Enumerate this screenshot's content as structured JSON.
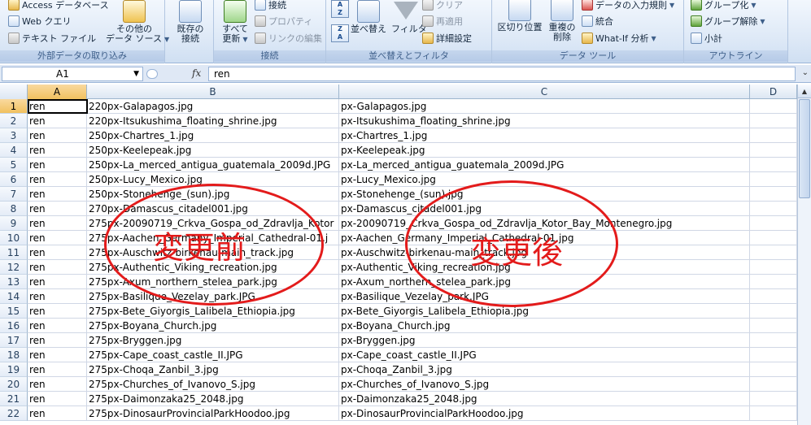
{
  "ribbon": {
    "groups": {
      "external": {
        "label": "外部データの取り込み",
        "access": "Access データベース",
        "web": "Web クエリ",
        "text": "テキスト ファイル",
        "other_l1": "その他の",
        "other_l2": "データ ソース"
      },
      "connections": {
        "label": "接続",
        "existing_l1": "既存の",
        "existing_l2": "接続",
        "refresh_l1": "すべて",
        "refresh_l2": "更新",
        "connections": "接続",
        "properties": "プロパティ",
        "edit_links": "リンクの編集"
      },
      "sort_filter": {
        "label": "並べ替えとフィルタ",
        "sort": "並べ替え",
        "filter": "フィルタ",
        "clear": "クリア",
        "reapply": "再適用",
        "advanced": "詳細設定"
      },
      "data_tools": {
        "label": "データ ツール",
        "text_to_columns": "区切り位置",
        "remove_dup_l1": "重複の",
        "remove_dup_l2": "削除",
        "validation": "データの入力規則",
        "consolidate": "統合",
        "whatif": "What-If 分析"
      },
      "outline": {
        "label": "アウトライン",
        "group": "グループ化",
        "ungroup": "グループ解除",
        "subtotal": "小計"
      }
    }
  },
  "formula_bar": {
    "name_box": "A1",
    "fx": "fx",
    "value": "ren"
  },
  "columns": [
    "A",
    "B",
    "C",
    "D"
  ],
  "rows": [
    {
      "n": "1",
      "a": "ren",
      "b": "220px-Galapagos.jpg",
      "c": "px-Galapagos.jpg"
    },
    {
      "n": "2",
      "a": "ren",
      "b": "220px-Itsukushima_floating_shrine.jpg",
      "c": "px-Itsukushima_floating_shrine.jpg"
    },
    {
      "n": "3",
      "a": "ren",
      "b": "250px-Chartres_1.jpg",
      "c": "px-Chartres_1.jpg"
    },
    {
      "n": "4",
      "a": "ren",
      "b": "250px-Keelepeak.jpg",
      "c": "px-Keelepeak.jpg"
    },
    {
      "n": "5",
      "a": "ren",
      "b": "250px-La_merced_antigua_guatemala_2009d.JPG",
      "c": "px-La_merced_antigua_guatemala_2009d.JPG"
    },
    {
      "n": "6",
      "a": "ren",
      "b": "250px-Lucy_Mexico.jpg",
      "c": "px-Lucy_Mexico.jpg"
    },
    {
      "n": "7",
      "a": "ren",
      "b": "250px-Stonehenge_(sun).jpg",
      "c": "px-Stonehenge_(sun).jpg"
    },
    {
      "n": "8",
      "a": "ren",
      "b": "270px-Damascus_citadel001.jpg",
      "c": "px-Damascus_citadel001.jpg"
    },
    {
      "n": "9",
      "a": "ren",
      "b": "275px-20090719_Crkva_Gospa_od_Zdravlja_Kotor",
      "c": "px-20090719_Crkva_Gospa_od_Zdravlja_Kotor_Bay_Montenegro.jpg"
    },
    {
      "n": "10",
      "a": "ren",
      "b": "275px-Aachen_Germany_Imperial_Cathedral-01.j",
      "c": "px-Aachen_Germany_Imperial_Cathedral-01.jpg"
    },
    {
      "n": "11",
      "a": "ren",
      "b": "275px-Auschwitz-birkenau-main_track.jpg",
      "c": "px-Auschwitz-birkenau-main_track.jpg"
    },
    {
      "n": "12",
      "a": "ren",
      "b": "275px-Authentic_Viking_recreation.jpg",
      "c": "px-Authentic_Viking_recreation.jpg"
    },
    {
      "n": "13",
      "a": "ren",
      "b": "275px-Axum_northern_stelea_park.jpg",
      "c": "px-Axum_northern_stelea_park.jpg"
    },
    {
      "n": "14",
      "a": "ren",
      "b": "275px-Basilique_Vezelay_park.JPG",
      "c": "px-Basilique_Vezelay_park.JPG"
    },
    {
      "n": "15",
      "a": "ren",
      "b": "275px-Bete_Giyorgis_Lalibela_Ethiopia.jpg",
      "c": "px-Bete_Giyorgis_Lalibela_Ethiopia.jpg"
    },
    {
      "n": "16",
      "a": "ren",
      "b": "275px-Boyana_Church.jpg",
      "c": "px-Boyana_Church.jpg"
    },
    {
      "n": "17",
      "a": "ren",
      "b": "275px-Bryggen.jpg",
      "c": "px-Bryggen.jpg"
    },
    {
      "n": "18",
      "a": "ren",
      "b": "275px-Cape_coast_castle_II.JPG",
      "c": "px-Cape_coast_castle_II.JPG"
    },
    {
      "n": "19",
      "a": "ren",
      "b": "275px-Choqa_Zanbil_3.jpg",
      "c": "px-Choqa_Zanbil_3.jpg"
    },
    {
      "n": "20",
      "a": "ren",
      "b": "275px-Churches_of_Ivanovo_S.jpg",
      "c": "px-Churches_of_Ivanovo_S.jpg"
    },
    {
      "n": "21",
      "a": "ren",
      "b": "275px-Daimonzaka25_2048.jpg",
      "c": "px-Daimonzaka25_2048.jpg"
    },
    {
      "n": "22",
      "a": "ren",
      "b": "275px-DinosaurProvincialParkHoodoo.jpg",
      "c": "px-DinosaurProvincialParkHoodoo.jpg"
    }
  ],
  "annotations": {
    "before": "変更前",
    "after": "変更後",
    "color": "#e31b1b"
  }
}
